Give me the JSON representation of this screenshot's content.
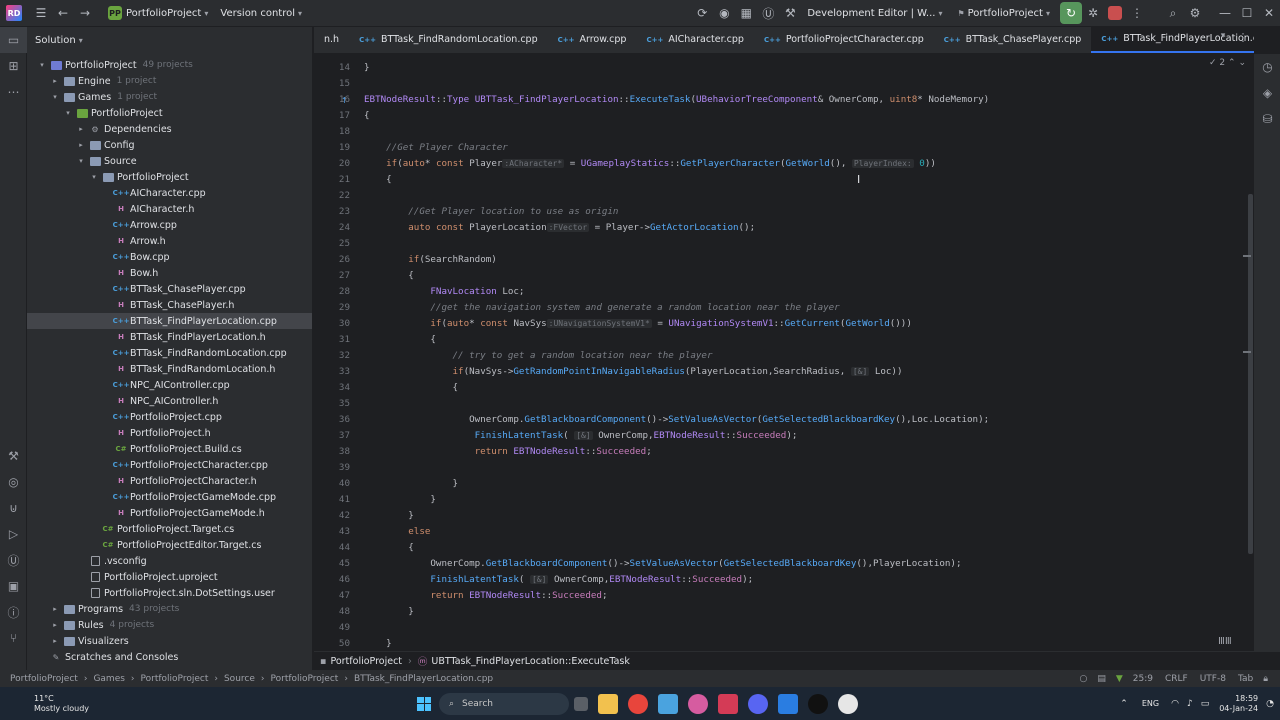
{
  "titlebar": {
    "logo": "RD",
    "project_badge": "PP",
    "project_name": "PortfolioProject",
    "version_control": "Version control",
    "run_config": "Development Editor | W...",
    "target": "PortfolioProject"
  },
  "solution": {
    "header": "Solution",
    "tree": [
      {
        "label": "PortfolioProject",
        "meta": "49 projects",
        "indent": 0,
        "twisty": "down",
        "icon": "solution"
      },
      {
        "label": "Engine",
        "meta": "1 project",
        "indent": 1,
        "twisty": "right",
        "icon": "folder"
      },
      {
        "label": "Games",
        "meta": "1 project",
        "indent": 1,
        "twisty": "down",
        "icon": "folder"
      },
      {
        "label": "PortfolioProject",
        "meta": "",
        "indent": 2,
        "twisty": "down",
        "icon": "project"
      },
      {
        "label": "Dependencies",
        "meta": "",
        "indent": 3,
        "twisty": "right",
        "icon": "deps"
      },
      {
        "label": "Config",
        "meta": "",
        "indent": 3,
        "twisty": "right",
        "icon": "folder"
      },
      {
        "label": "Source",
        "meta": "",
        "indent": 3,
        "twisty": "down",
        "icon": "folder"
      },
      {
        "label": "PortfolioProject",
        "meta": "",
        "indent": 4,
        "twisty": "down",
        "icon": "folder"
      },
      {
        "label": "AICharacter.cpp",
        "meta": "",
        "indent": 5,
        "twisty": "",
        "icon": "cpp"
      },
      {
        "label": "AICharacter.h",
        "meta": "",
        "indent": 5,
        "twisty": "",
        "icon": "h"
      },
      {
        "label": "Arrow.cpp",
        "meta": "",
        "indent": 5,
        "twisty": "",
        "icon": "cpp"
      },
      {
        "label": "Arrow.h",
        "meta": "",
        "indent": 5,
        "twisty": "",
        "icon": "h"
      },
      {
        "label": "Bow.cpp",
        "meta": "",
        "indent": 5,
        "twisty": "",
        "icon": "cpp"
      },
      {
        "label": "Bow.h",
        "meta": "",
        "indent": 5,
        "twisty": "",
        "icon": "h"
      },
      {
        "label": "BTTask_ChasePlayer.cpp",
        "meta": "",
        "indent": 5,
        "twisty": "",
        "icon": "cpp"
      },
      {
        "label": "BTTask_ChasePlayer.h",
        "meta": "",
        "indent": 5,
        "twisty": "",
        "icon": "h"
      },
      {
        "label": "BTTask_FindPlayerLocation.cpp",
        "meta": "",
        "indent": 5,
        "twisty": "",
        "icon": "cpp",
        "selected": true
      },
      {
        "label": "BTTask_FindPlayerLocation.h",
        "meta": "",
        "indent": 5,
        "twisty": "",
        "icon": "h"
      },
      {
        "label": "BTTask_FindRandomLocation.cpp",
        "meta": "",
        "indent": 5,
        "twisty": "",
        "icon": "cpp"
      },
      {
        "label": "BTTask_FindRandomLocation.h",
        "meta": "",
        "indent": 5,
        "twisty": "",
        "icon": "h"
      },
      {
        "label": "NPC_AIController.cpp",
        "meta": "",
        "indent": 5,
        "twisty": "",
        "icon": "cpp"
      },
      {
        "label": "NPC_AIController.h",
        "meta": "",
        "indent": 5,
        "twisty": "",
        "icon": "h"
      },
      {
        "label": "PortfolioProject.cpp",
        "meta": "",
        "indent": 5,
        "twisty": "",
        "icon": "cpp"
      },
      {
        "label": "PortfolioProject.h",
        "meta": "",
        "indent": 5,
        "twisty": "",
        "icon": "h"
      },
      {
        "label": "PortfolioProject.Build.cs",
        "meta": "",
        "indent": 5,
        "twisty": "",
        "icon": "cs"
      },
      {
        "label": "PortfolioProjectCharacter.cpp",
        "meta": "",
        "indent": 5,
        "twisty": "",
        "icon": "cpp"
      },
      {
        "label": "PortfolioProjectCharacter.h",
        "meta": "",
        "indent": 5,
        "twisty": "",
        "icon": "h"
      },
      {
        "label": "PortfolioProjectGameMode.cpp",
        "meta": "",
        "indent": 5,
        "twisty": "",
        "icon": "cpp"
      },
      {
        "label": "PortfolioProjectGameMode.h",
        "meta": "",
        "indent": 5,
        "twisty": "",
        "icon": "h"
      },
      {
        "label": "PortfolioProject.Target.cs",
        "meta": "",
        "indent": 4,
        "twisty": "",
        "icon": "cs"
      },
      {
        "label": "PortfolioProjectEditor.Target.cs",
        "meta": "",
        "indent": 4,
        "twisty": "",
        "icon": "cs"
      },
      {
        "label": ".vsconfig",
        "meta": "",
        "indent": 3,
        "twisty": "",
        "icon": "file"
      },
      {
        "label": "PortfolioProject.uproject",
        "meta": "",
        "indent": 3,
        "twisty": "",
        "icon": "file"
      },
      {
        "label": "PortfolioProject.sln.DotSettings.user",
        "meta": "",
        "indent": 3,
        "twisty": "",
        "icon": "file"
      },
      {
        "label": "Programs",
        "meta": "43 projects",
        "indent": 1,
        "twisty": "right",
        "icon": "folder"
      },
      {
        "label": "Rules",
        "meta": "4 projects",
        "indent": 1,
        "twisty": "right",
        "icon": "folder"
      },
      {
        "label": "Visualizers",
        "meta": "",
        "indent": 1,
        "twisty": "right",
        "icon": "folder"
      },
      {
        "label": "Scratches and Consoles",
        "meta": "",
        "indent": 0,
        "twisty": "",
        "icon": "scratch"
      }
    ]
  },
  "tabs": [
    {
      "label": "n.h",
      "active": false
    },
    {
      "label": "BTTask_FindRandomLocation.cpp",
      "active": false
    },
    {
      "label": "Arrow.cpp",
      "active": false
    },
    {
      "label": "AICharacter.cpp",
      "active": false
    },
    {
      "label": "PortfolioProjectCharacter.cpp",
      "active": false
    },
    {
      "label": "BTTask_ChasePlayer.cpp",
      "active": false
    },
    {
      "label": "BTTask_FindPlayerLocation.cpp",
      "active": true
    }
  ],
  "editor": {
    "inspection_count": "2",
    "lines": [
      {
        "n": "14",
        "html": "}"
      },
      {
        "n": "15",
        "html": ""
      },
      {
        "n": "16",
        "html": "<span class='ty'>EBTNodeResult</span>::<span class='ty'>Type</span> <span class='ty'>UBTTask_FindPlayerLocation</span>::<span class='fn'>ExecuteTask</span>(<span class='ty'>UBehaviorTreeComponent</span>&amp; OwnerComp, <span class='kw'>uint8</span>* NodeMemory)"
      },
      {
        "n": "17",
        "html": "{"
      },
      {
        "n": "18",
        "html": ""
      },
      {
        "n": "19",
        "html": "    <span class='cm'>//Get Player Character</span>"
      },
      {
        "n": "20",
        "html": "    <span class='kw'>if</span>(<span class='kw'>auto</span>* <span class='kw'>const</span> Player<span class='hint'>:ACharacter*</span> = <span class='ty'>UGameplayStatics</span>::<span class='fn'>GetPlayerCharacter</span>(<span class='fn'>GetWorld</span>(), <span class='hint'>PlayerIndex:</span> <span class='num'>0</span>))"
      },
      {
        "n": "21",
        "html": "    {"
      },
      {
        "n": "22",
        "html": ""
      },
      {
        "n": "23",
        "html": "        <span class='cm'>//Get Player location to use as origin</span>"
      },
      {
        "n": "24",
        "html": "        <span class='kw'>auto</span> <span class='kw'>const</span> PlayerLocation<span class='hint'>:FVector</span> = Player-><span class='fn'>GetActorLocation</span>();"
      },
      {
        "n": "25",
        "html": ""
      },
      {
        "n": "26",
        "html": "        <span class='kw'>if</span>(SearchRandom)"
      },
      {
        "n": "27",
        "html": "        {"
      },
      {
        "n": "28",
        "html": "            <span class='ty'>FNavLocation</span> Loc;"
      },
      {
        "n": "29",
        "html": "            <span class='cm'>//get the navigation system and generate a random location near the player</span>"
      },
      {
        "n": "30",
        "html": "            <span class='kw'>if</span>(<span class='kw'>auto</span>* <span class='kw'>const</span> NavSys<span class='hint'>:UNavigationSystemV1*</span> = <span class='ty'>UNavigationSystemV1</span>::<span class='fn'>GetCurrent</span>(<span class='fn'>GetWorld</span>()))"
      },
      {
        "n": "31",
        "html": "            {"
      },
      {
        "n": "32",
        "html": "                <span class='cm'>// try to get a random location near the player</span>"
      },
      {
        "n": "33",
        "html": "                <span class='kw'>if</span>(NavSys-><span class='fn'>GetRandomPointInNavigableRadius</span>(PlayerLocation,SearchRadius, <span class='hint'>[&amp;]</span> Loc))"
      },
      {
        "n": "34",
        "html": "                {"
      },
      {
        "n": "35",
        "html": ""
      },
      {
        "n": "36",
        "html": "                   OwnerComp.<span class='fn'>GetBlackboardComponent</span>()-><span class='fn'>SetValueAsVector</span>(<span class='fn'>GetSelectedBlackboardKey</span>(),Loc.Location);"
      },
      {
        "n": "37",
        "html": "                    <span class='fn'>FinishLatentTask</span>( <span class='hint'>[&amp;]</span> OwnerComp,<span class='ty'>EBTNodeResult</span>::<span class='enm'>Succeeded</span>);"
      },
      {
        "n": "38",
        "html": "                    <span class='kw'>return</span> <span class='ty'>EBTNodeResult</span>::<span class='enm'>Succeeded</span>;"
      },
      {
        "n": "39",
        "html": ""
      },
      {
        "n": "40",
        "html": "                }"
      },
      {
        "n": "41",
        "html": "            }"
      },
      {
        "n": "42",
        "html": "        }"
      },
      {
        "n": "43",
        "html": "        <span class='kw'>else</span>"
      },
      {
        "n": "44",
        "html": "        {"
      },
      {
        "n": "45",
        "html": "            OwnerComp.<span class='fn'>GetBlackboardComponent</span>()-><span class='fn'>SetValueAsVector</span>(<span class='fn'>GetSelectedBlackboardKey</span>(),PlayerLocation);"
      },
      {
        "n": "46",
        "html": "            <span class='fn'>FinishLatentTask</span>( <span class='hint'>[&amp;]</span> OwnerComp,<span class='ty'>EBTNodeResult</span>::<span class='enm'>Succeeded</span>);"
      },
      {
        "n": "47",
        "html": "            <span class='kw'>return</span> <span class='ty'>EBTNodeResult</span>::<span class='enm'>Succeeded</span>;"
      },
      {
        "n": "48",
        "html": "        }"
      },
      {
        "n": "49",
        "html": ""
      },
      {
        "n": "50",
        "html": "    }"
      }
    ]
  },
  "breadcrumb_bar": {
    "project": "PortfolioProject",
    "member": "UBTTask_FindPlayerLocation::ExecuteTask"
  },
  "statusbar": {
    "path": [
      "PortfolioProject",
      "Games",
      "PortfolioProject",
      "Source",
      "PortfolioProject",
      "BTTask_FindPlayerLocation.cpp"
    ],
    "position": "25:9",
    "line_ending": "CRLF",
    "encoding": "UTF-8",
    "indent": "Tab"
  },
  "taskbar": {
    "temperature": "11°C",
    "weather": "Mostly cloudy",
    "search": "Search",
    "language": "ENG",
    "time": "18:59",
    "date": "04-Jan-24"
  },
  "colors": {
    "accent": "#3574f0",
    "run_green": "#57965c",
    "stop_red": "#c94f4f"
  }
}
